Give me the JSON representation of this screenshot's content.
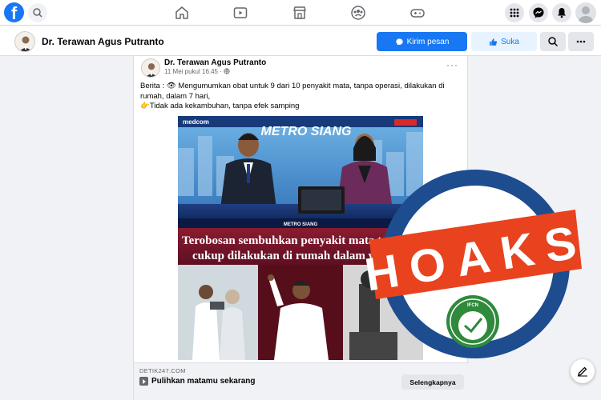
{
  "page": {
    "name": "Dr. Terawan Agus Putranto",
    "message_button": "Kirim pesan",
    "like_button": "Suka"
  },
  "post": {
    "author": "Dr. Terawan Agus Putranto",
    "time": "11 Mei pukul 16.45 ·",
    "text_line1": "Berita : 👁 Mengumumkan obat untuk 9 dari 10 penyakit mata, tanpa operasi, dilakukan di rumah, dalam 7 hari,",
    "text_line2": "👉Tidak ada kekambuhan, tanpa efek samping",
    "media": {
      "channel_logo": "medcom",
      "show_title": "METRO SIANG",
      "lower_third": "METRO SIANG",
      "caption_line1": "Terobosan sembuhkan penyakit mata tanpa",
      "caption_line2": "cukup dilakukan di rumah dalam wa"
    },
    "link": {
      "domain": "DETIK247.COM",
      "title": "Pulihkan matamu sekarang",
      "button": "Selengkapnya"
    }
  },
  "stamp": {
    "label": "HOAKS",
    "seal_text": "IFCN",
    "colors": {
      "ring": "#1d4d8f",
      "banner": "#e8431e",
      "seal": "#2f8a3c"
    }
  },
  "icons": [
    "facebook-logo",
    "search-icon",
    "home-icon",
    "watch-icon",
    "marketplace-icon",
    "groups-icon",
    "gaming-icon",
    "menu-grid-icon",
    "messenger-icon",
    "notifications-icon",
    "thumb-up-icon",
    "more-icon",
    "edit-icon"
  ]
}
